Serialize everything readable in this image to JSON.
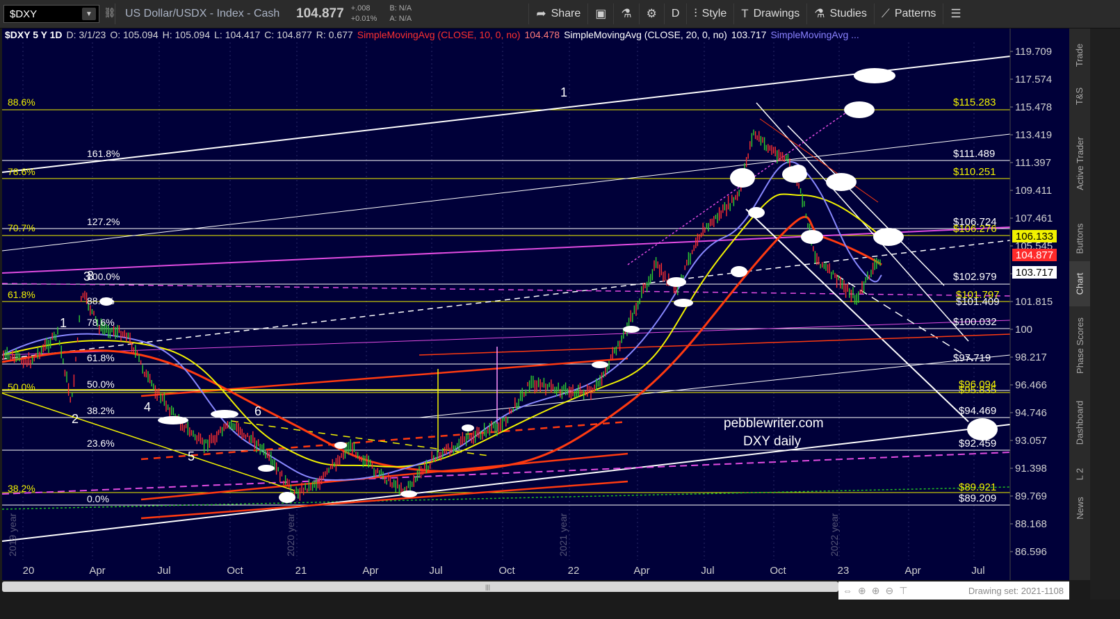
{
  "toolbar": {
    "symbol": "$DXY",
    "instrument": "US Dollar/USDX - Index - Cash",
    "last": "104.877",
    "change": "+.008",
    "change_pct": "+0.01%",
    "bid": "B: N/A",
    "ask": "A: N/A",
    "buttons": {
      "share": "Share",
      "period": "D",
      "style": "Style",
      "drawings": "Drawings",
      "studies": "Studies",
      "patterns": "Patterns"
    }
  },
  "header": {
    "symbol": "$DXY 5 Y 1D",
    "date": "D: 3/1/23",
    "open": "O: 105.094",
    "high": "H: 105.094",
    "low": "L: 104.417",
    "close": "C: 104.877",
    "range": "R: 0.677",
    "sma10_label": "SimpleMovingAvg (CLOSE, 10, 0, no)",
    "sma10_value": "104.478",
    "sma20_label": "SimpleMovingAvg (CLOSE, 20, 0, no)",
    "sma20_value": "103.717",
    "sma_more": "SimpleMovingAvg ..."
  },
  "colors": {
    "chart_bg": "#000039",
    "yellow": "#f2f200",
    "white": "#ffffff",
    "magenta": "#e24ce2",
    "red": "#ff3a10",
    "blue_ma": "#8888ff",
    "green": "#20c020"
  },
  "price_axis": [
    "119.709",
    "117.574",
    "115.478",
    "113.419",
    "111.397",
    "109.411",
    "107.461",
    "105.545",
    "103.717",
    "101.815",
    "100",
    "98.217",
    "96.466",
    "94.746",
    "93.057",
    "91.398",
    "89.769",
    "88.168",
    "86.596"
  ],
  "price_badges": {
    "upper": "106.133",
    "last": "104.877",
    "sma": "103.717"
  },
  "time_axis": [
    "20",
    "Apr",
    "Jul",
    "Oct",
    "21",
    "Apr",
    "Jul",
    "Oct",
    "22",
    "Apr",
    "Jul",
    "Oct",
    "23",
    "Apr",
    "Jul"
  ],
  "year_labels": [
    "2019 year",
    "2020 year",
    "2021 year",
    "2022 year"
  ],
  "fib_left": [
    "88.6%",
    "78.6%",
    "70.7%",
    "61.8%",
    "50.0%",
    "38.2%"
  ],
  "fib_inner": [
    "161.8%",
    "127.2%",
    "100.0%",
    "88.6%",
    "78.6%",
    "61.8%",
    "50.0%",
    "38.2%",
    "23.6%",
    "0.0%"
  ],
  "price_targets": [
    "$115.283",
    "$111.489",
    "$110.251",
    "$106.724",
    "$106.276",
    "$102.979",
    "$101.797",
    "$101.409",
    "$100.032",
    "$97.719",
    "$96.094",
    "$95.835",
    "$94.469",
    "$92.459",
    "$89.921",
    "$89.209"
  ],
  "wave_labels": [
    "1",
    "1",
    "2",
    "3",
    "4",
    "5",
    "6",
    "3"
  ],
  "watermark": {
    "site": "pebblewriter.com",
    "caption": "DXY daily"
  },
  "right_tabs": [
    "Trade",
    "T&S",
    "Active Trader",
    "Buttons",
    "Chart",
    "Phase Scores",
    "Dashboard",
    "L 2",
    "News"
  ],
  "drawing_set": "Drawing set: 2021-1108"
}
